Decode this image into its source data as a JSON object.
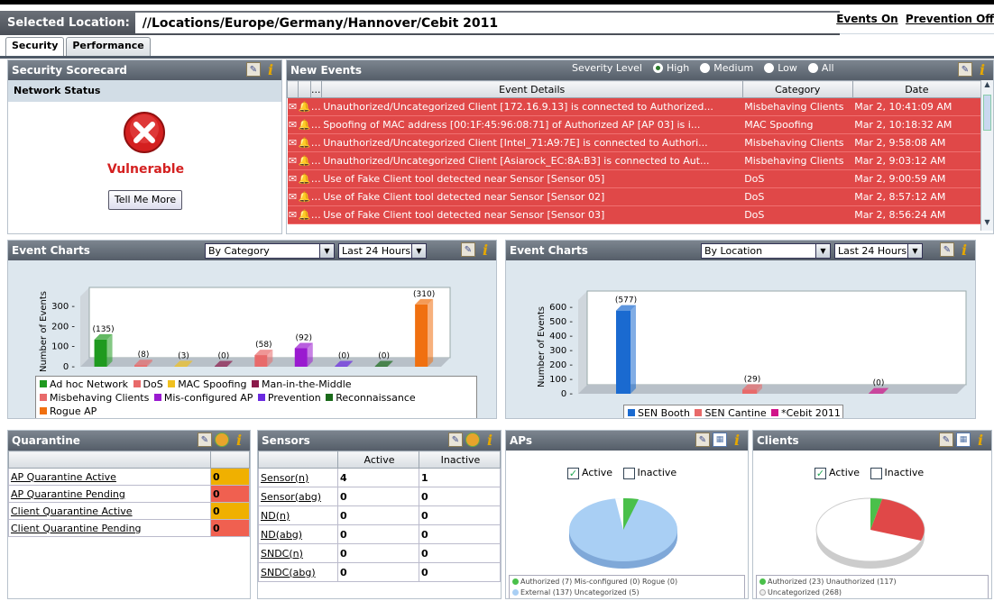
{
  "header": {
    "selected_location_label": "Selected Location:",
    "location_path": "//Locations/Europe/Germany/Hannover/Cebit 2011",
    "events_on": "Events On",
    "prevention_off": "Prevention Off"
  },
  "tabs": [
    {
      "label": "Security"
    },
    {
      "label": "Performance"
    }
  ],
  "scorecard": {
    "title": "Security Scorecard",
    "network_status": "Network Status",
    "status": "Vulnerable",
    "tell_more": "Tell Me More"
  },
  "new_events": {
    "title": "New Events",
    "severity_label": "Severity Level",
    "severity_options": [
      "High",
      "Medium",
      "Low",
      "All"
    ],
    "severity_selected": "High",
    "columns": [
      "...",
      "Event Details",
      "Category",
      "Date"
    ],
    "rows": [
      {
        "details": "Unauthorized/Uncategorized Client [172.16.9.13] is connected to Authorized...",
        "category": "Misbehaving Clients",
        "date": "Mar 2, 10:41:09 AM"
      },
      {
        "details": "Spoofing of MAC address [00:1F:45:96:08:71] of Authorized AP [AP 03] is i...",
        "category": "MAC Spoofing",
        "date": "Mar 2, 10:18:32 AM"
      },
      {
        "details": "Unauthorized/Uncategorized Client [Intel_71:A9:7E] is connected to Authori...",
        "category": "Misbehaving Clients",
        "date": "Mar 2, 9:58:08 AM"
      },
      {
        "details": "Unauthorized/Uncategorized Client [Asiarock_EC:8A:B3] is connected to Aut...",
        "category": "Misbehaving Clients",
        "date": "Mar 2, 9:03:12 AM"
      },
      {
        "details": "Use of Fake Client tool detected near Sensor [Sensor 05]",
        "category": "DoS",
        "date": "Mar 2, 9:00:59 AM"
      },
      {
        "details": "Use of Fake Client tool detected near Sensor [Sensor 02]",
        "category": "DoS",
        "date": "Mar 2, 8:57:12 AM"
      },
      {
        "details": "Use of Fake Client tool detected near Sensor [Sensor 03]",
        "category": "DoS",
        "date": "Mar 2, 8:56:24 AM"
      }
    ]
  },
  "event_charts_left": {
    "title": "Event Charts",
    "group_by": "By Category",
    "period": "Last 24 Hours"
  },
  "event_charts_right": {
    "title": "Event Charts",
    "group_by": "By Location",
    "period": "Last 24 Hours"
  },
  "chart_data": [
    {
      "type": "bar",
      "ylabel": "Number of Events",
      "ylim": [
        0,
        350
      ],
      "yticks": [
        "0",
        "100",
        "200",
        "300"
      ],
      "categories": [
        "Ad hoc Network",
        "DoS",
        "MAC Spoofing",
        "Man-in-the-Middle",
        "Misbehaving Clients",
        "Mis-configured AP",
        "Prevention",
        "Reconnaissance",
        "Rogue AP"
      ],
      "values": [
        135,
        8,
        3,
        0,
        58,
        92,
        0,
        0,
        310
      ],
      "labels": [
        "(135)",
        "(8)",
        "(3)",
        "(0)",
        "(58)",
        "(92)",
        "(0)",
        "(0)",
        "(310)"
      ],
      "colors": [
        "#1f9a1f",
        "#e86a6a",
        "#f0c020",
        "#8a1a4a",
        "#e86a6a",
        "#9a1ad0",
        "#6a2ae0",
        "#1a6a1a",
        "#f07010"
      ],
      "legend": [
        "Ad hoc Network",
        "DoS",
        "MAC Spoofing",
        "Man-in-the-Middle",
        "Misbehaving Clients",
        "Mis-configured AP",
        "Prevention",
        "Reconnaissance",
        "Rogue AP"
      ]
    },
    {
      "type": "bar",
      "ylabel": "Number of Events",
      "ylim": [
        0,
        650
      ],
      "yticks": [
        "0",
        "100",
        "200",
        "300",
        "400",
        "500",
        "600"
      ],
      "categories": [
        "SEN Booth",
        "SEN Cantine",
        "*Cebit 2011"
      ],
      "values": [
        577,
        29,
        0
      ],
      "labels": [
        "(577)",
        "(29)",
        "(0)"
      ],
      "colors": [
        "#1a6ad0",
        "#e86a6a",
        "#d0148a"
      ],
      "legend": [
        "SEN Booth",
        "SEN Cantine",
        "*Cebit 2011"
      ]
    }
  ],
  "quarantine": {
    "title": "Quarantine",
    "rows": [
      {
        "label": "AP Quarantine Active",
        "value": "0",
        "color": "#f0b000"
      },
      {
        "label": "AP Quarantine Pending",
        "value": "0",
        "color": "#f06050"
      },
      {
        "label": "Client Quarantine Active",
        "value": "0",
        "color": "#f0b000"
      },
      {
        "label": "Client Quarantine Pending",
        "value": "0",
        "color": "#f06050"
      }
    ]
  },
  "sensors": {
    "title": "Sensors",
    "col_active": "Active",
    "col_inactive": "Inactive",
    "rows": [
      {
        "label": "Sensor(n)",
        "active": "4",
        "inactive": "1"
      },
      {
        "label": "Sensor(abg)",
        "active": "0",
        "inactive": "0"
      },
      {
        "label": "ND(n)",
        "active": "0",
        "inactive": "0"
      },
      {
        "label": "ND(abg)",
        "active": "0",
        "inactive": "0"
      },
      {
        "label": "SNDC(n)",
        "active": "0",
        "inactive": "0"
      },
      {
        "label": "SNDC(abg)",
        "active": "0",
        "inactive": "0"
      }
    ]
  },
  "aps": {
    "title": "APs",
    "active_label": "Active",
    "inactive_label": "Inactive",
    "legend_line1": "Authorized (7)  Mis-configured (0)  Rogue (0)",
    "legend_line2": "External (137)  Uncategorized (5)"
  },
  "clients": {
    "title": "Clients",
    "active_label": "Active",
    "inactive_label": "Inactive",
    "legend_line1": "Authorized (23)  Unauthorized (117)",
    "legend_line2": "Uncategorized (268)"
  }
}
